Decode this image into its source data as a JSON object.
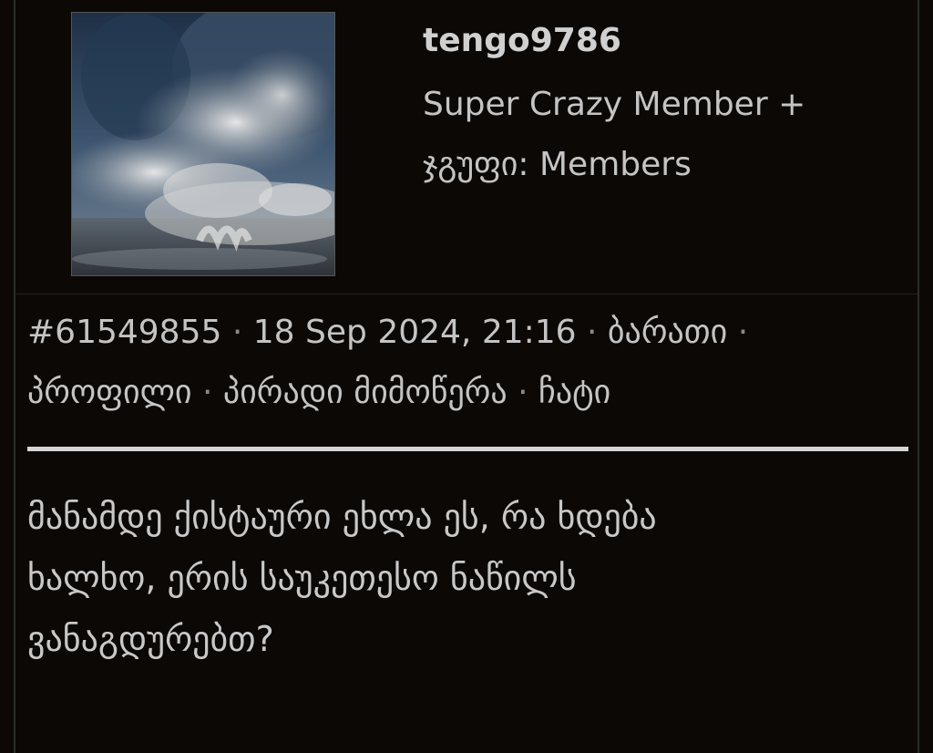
{
  "user": {
    "username": "tengo9786",
    "rank": "Super Crazy Member +",
    "group": "ჯგუფი: Members"
  },
  "post_meta": {
    "post_id": "#61549855",
    "datetime": "18 Sep 2024, 21:16",
    "separator": "·",
    "links": {
      "card": "ბარათი",
      "profile": "პროფილი",
      "private_message": "პირადი მიმოწერა",
      "chat": "ჩატი"
    }
  },
  "post": {
    "lines": [
      "მანამდე ქისტაური ეხლა ეს, რა ხდება",
      "ხალხო, ერის საუკეთესო ნაწილს",
      "ვანაგდურებთ?"
    ]
  },
  "colors": {
    "background": "#0b0806",
    "text": "#c4c4c4",
    "divider": "#d6d6d6",
    "border": "#2b2b2b"
  }
}
